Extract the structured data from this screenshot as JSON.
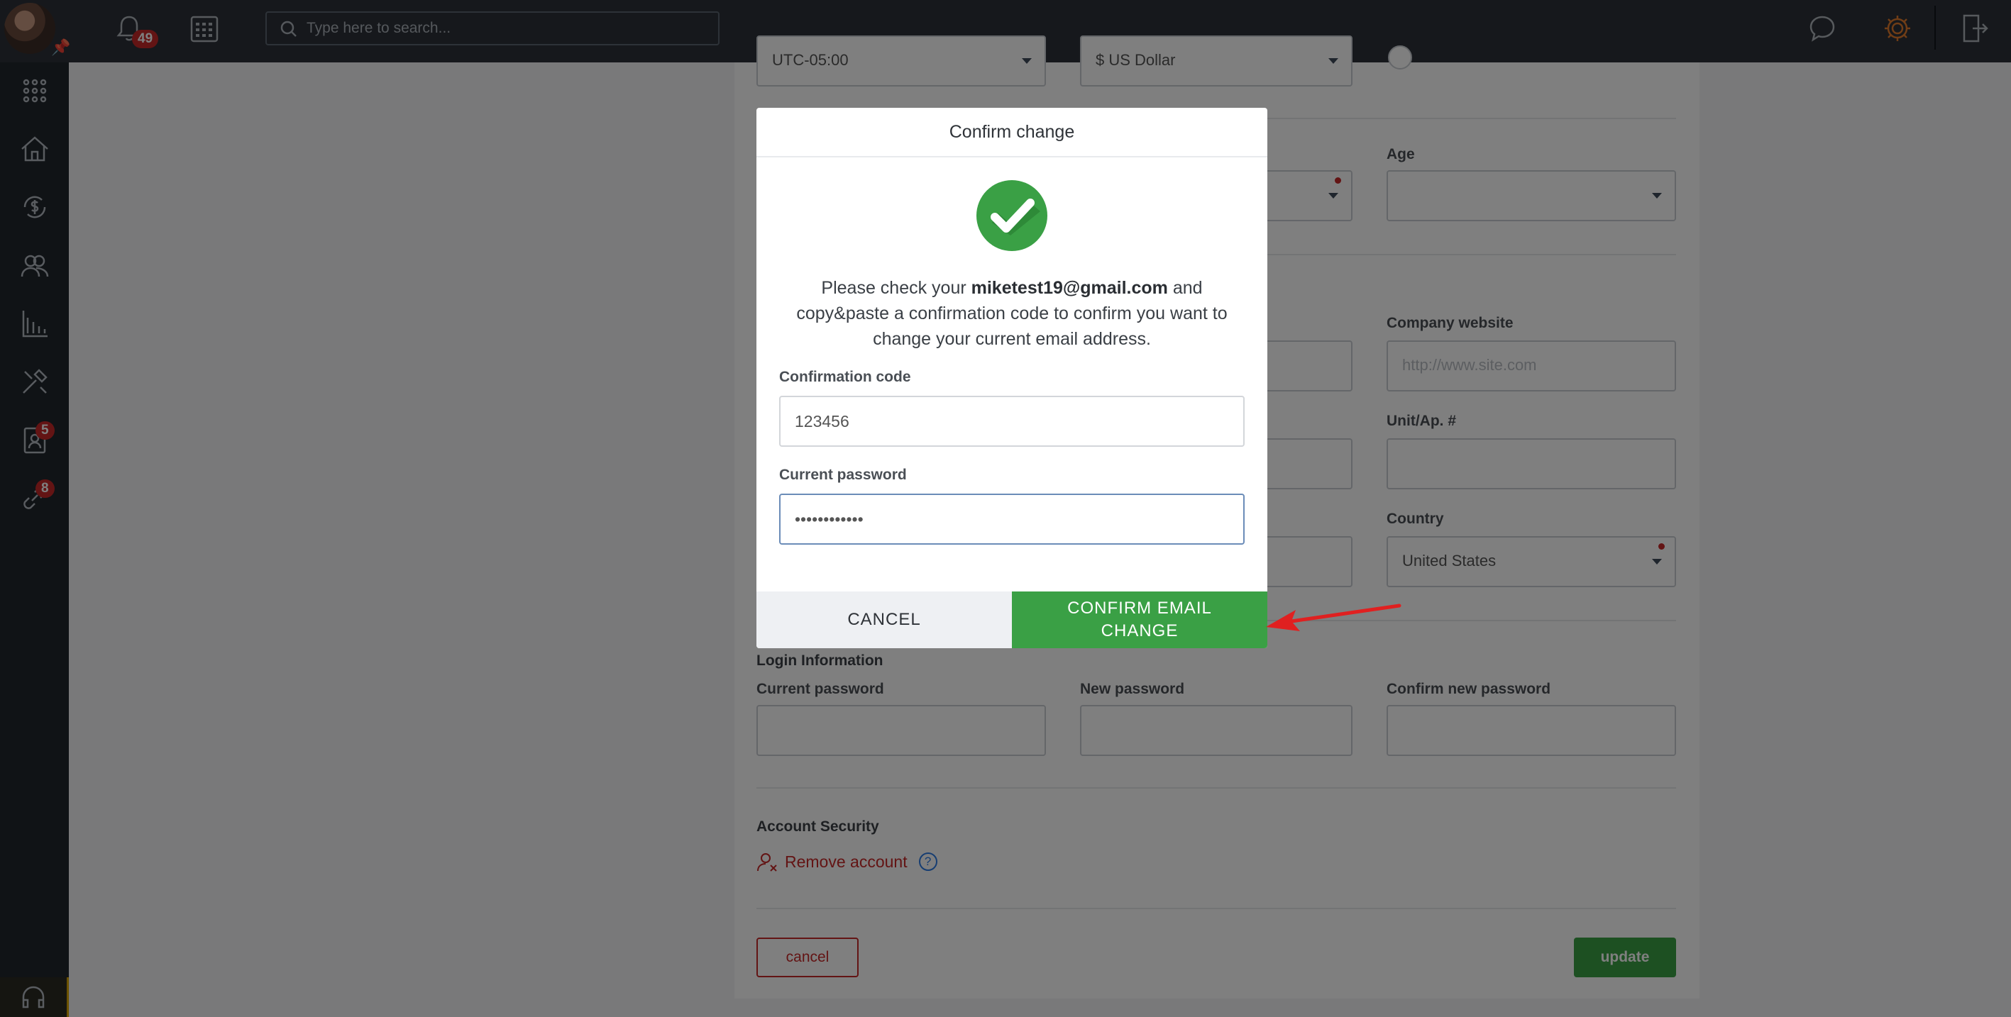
{
  "topbar": {
    "notifications_count": "49",
    "search_placeholder": "Type here to search..."
  },
  "sidebar": {
    "items": [
      {
        "icon": "apps-grid-icon"
      },
      {
        "icon": "home-icon"
      },
      {
        "icon": "finance-icon"
      },
      {
        "icon": "contacts-icon"
      },
      {
        "icon": "reports-icon"
      },
      {
        "icon": "tools-icon"
      },
      {
        "icon": "tenant-icon",
        "badge": "5"
      },
      {
        "icon": "link-icon",
        "badge": "8"
      }
    ]
  },
  "form": {
    "timezone_value": "UTC-05:00",
    "currency_value": "$ US Dollar",
    "age_label": "Age",
    "company_website_label": "Company website",
    "company_website_placeholder": "http://www.site.com",
    "unit_label": "Unit/Ap. #",
    "country_label": "Country",
    "country_value": "United States",
    "login_section": "Login Information",
    "current_password_label": "Current password",
    "new_password_label": "New password",
    "confirm_new_password_label": "Confirm new password",
    "account_security_section": "Account Security",
    "remove_account": "Remove account",
    "help": "?",
    "cancel_button": "cancel",
    "update_button": "update"
  },
  "modal": {
    "title": "Confirm change",
    "message_before": "Please check your ",
    "email": "miketest19@gmail.com",
    "message_after": " and copy&paste a confirmation code to confirm you want to change your current email address.",
    "code_label": "Confirmation code",
    "code_value": "123456",
    "password_label": "Current password",
    "password_value": "••••••••••••",
    "cancel_button": "CANCEL",
    "confirm_button": "CONFIRM EMAIL CHANGE"
  },
  "colors": {
    "accent_green": "#3aa045",
    "danger_red": "#c62828",
    "topbar_bg": "#2c3138",
    "sidebar_bg": "#20262d"
  }
}
